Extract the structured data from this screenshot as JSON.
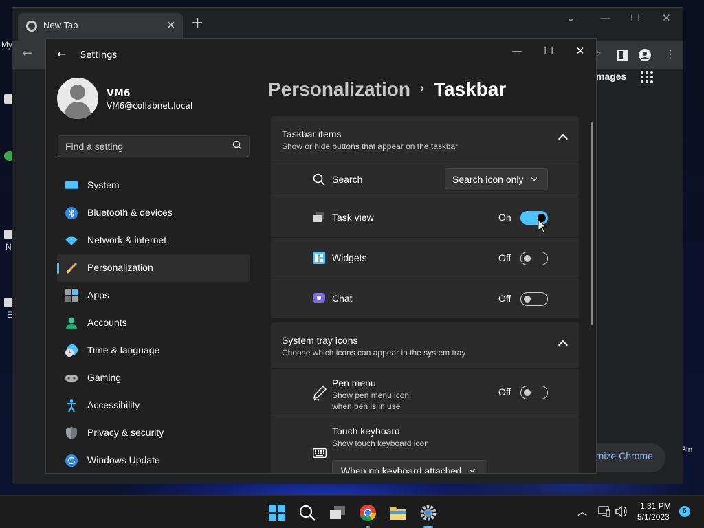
{
  "desktop": {
    "left_labels": [
      "My",
      "N",
      "E"
    ],
    "right_label": "Bin"
  },
  "chrome": {
    "tab_title": "New Tab",
    "images_link": "Images",
    "customize_label": "stomize Chrome"
  },
  "settings": {
    "window_title": "Settings",
    "user": {
      "name": "VM6",
      "email": "VM6@collabnet.local"
    },
    "search_placeholder": "Find a setting",
    "nav": [
      {
        "label": "System",
        "icon": "system-icon"
      },
      {
        "label": "Bluetooth & devices",
        "icon": "bluetooth-icon"
      },
      {
        "label": "Network & internet",
        "icon": "wifi-icon"
      },
      {
        "label": "Personalization",
        "icon": "brush-icon",
        "active": true
      },
      {
        "label": "Apps",
        "icon": "apps-icon"
      },
      {
        "label": "Accounts",
        "icon": "accounts-icon"
      },
      {
        "label": "Time & language",
        "icon": "clock-globe-icon"
      },
      {
        "label": "Gaming",
        "icon": "gamepad-icon"
      },
      {
        "label": "Accessibility",
        "icon": "accessibility-icon"
      },
      {
        "label": "Privacy & security",
        "icon": "shield-icon"
      },
      {
        "label": "Windows Update",
        "icon": "update-icon"
      }
    ],
    "breadcrumb": {
      "parent": "Personalization",
      "separator": "›",
      "current": "Taskbar"
    },
    "taskbar_items": {
      "title": "Taskbar items",
      "subtitle": "Show or hide buttons that appear on the taskbar",
      "search": {
        "label": "Search",
        "value": "Search icon only"
      },
      "task_view": {
        "label": "Task view",
        "state": "On",
        "on": true
      },
      "widgets": {
        "label": "Widgets",
        "state": "Off",
        "on": false
      },
      "chat": {
        "label": "Chat",
        "state": "Off",
        "on": false
      }
    },
    "system_tray": {
      "title": "System tray icons",
      "subtitle": "Choose which icons can appear in the system tray",
      "pen_menu": {
        "label": "Pen menu",
        "sub1": "Show pen menu icon",
        "sub2": "when pen is in use",
        "state": "Off",
        "on": false
      },
      "touch_keyboard": {
        "label": "Touch keyboard",
        "sub": "Show touch keyboard icon",
        "value": "When no keyboard attached"
      }
    }
  },
  "taskbar": {
    "time": "1:31 PM",
    "date": "5/1/2023",
    "notification_count": "5"
  },
  "colors": {
    "accent": "#4cc2ff",
    "window_bg": "#202020",
    "card_bg": "#2b2b2b"
  }
}
